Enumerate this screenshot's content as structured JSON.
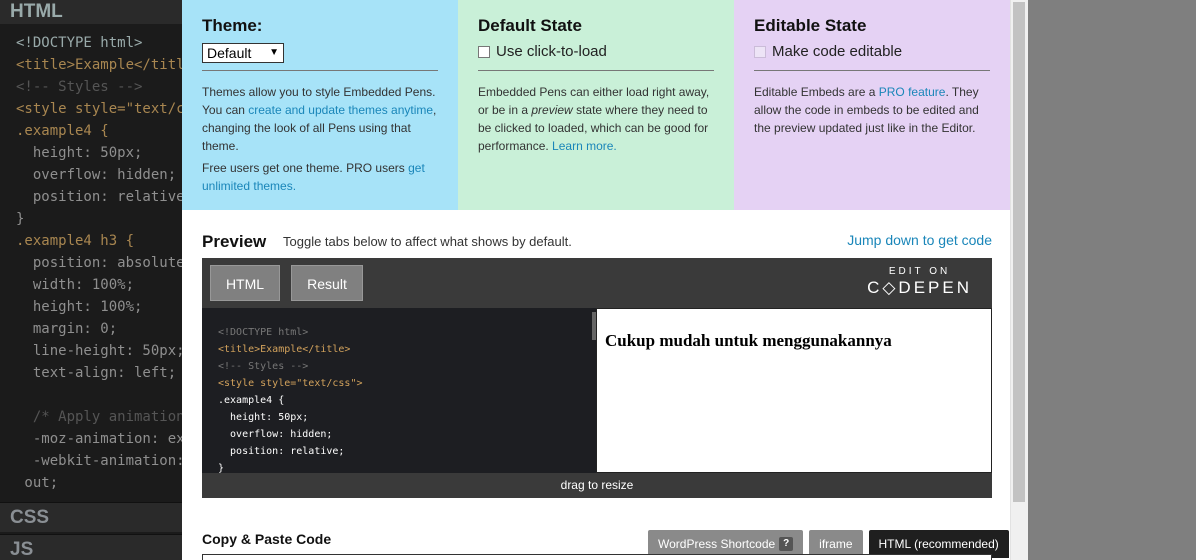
{
  "background": {
    "html_panel_title": "HTML",
    "css_panel_title": "CSS",
    "js_panel_title": "JS",
    "code_lines": [
      "<!DOCTYPE html>",
      "<title>Example</title>",
      "<!-- Styles -->",
      "<style style=\"text/c",
      ".example4 {",
      "  height: 50px;",
      "  overflow: hidden;",
      "  position: relative;",
      "}",
      ".example4 h3 {",
      "  position: absolute;",
      "  width: 100%;",
      "  height: 100%;",
      "  margin: 0;",
      "  line-height: 50px;",
      "  text-align: left;",
      "",
      "  /* Apply animation",
      "  -moz-animation: exa",
      "  -webkit-animation:",
      " out;"
    ]
  },
  "theme": {
    "title": "Theme:",
    "selected": "Default",
    "text1": "Themes allow you to style Embedded Pens. You can ",
    "link1": "create and update themes anytime",
    "text2": ", changing the look of all Pens using that theme.",
    "text3": "Free users get one theme. PRO users ",
    "link2": "get unlimited themes."
  },
  "default_state": {
    "title": "Default State",
    "checkbox_label": "Use click-to-load",
    "text1": "Embedded Pens can either load right away, or be in a ",
    "text_em": "preview",
    "text2": " state where they need to be clicked to loaded, which can be good for performance. ",
    "link": "Learn more."
  },
  "editable_state": {
    "title": "Editable State",
    "checkbox_label": "Make code editable",
    "text1": "Editable Embeds are a ",
    "link": "PRO feature",
    "text2": ". They allow the code in embeds to be edited and the preview updated just like in the Editor."
  },
  "preview": {
    "title": "Preview",
    "hint": "Toggle tabs below to affect what shows by default.",
    "jump_link": "Jump down to get code",
    "tab_html": "HTML",
    "tab_result": "Result",
    "brand_edit": "EDIT ON",
    "brand_name": "C◇DEPEN",
    "result_heading": "Cukup mudah untuk menggunakannya",
    "drag_label": "drag to resize"
  },
  "copy": {
    "title": "Copy & Paste Code",
    "tabs": [
      "WordPress Shortcode",
      "iframe",
      "HTML (recommended)"
    ],
    "help": "?"
  }
}
